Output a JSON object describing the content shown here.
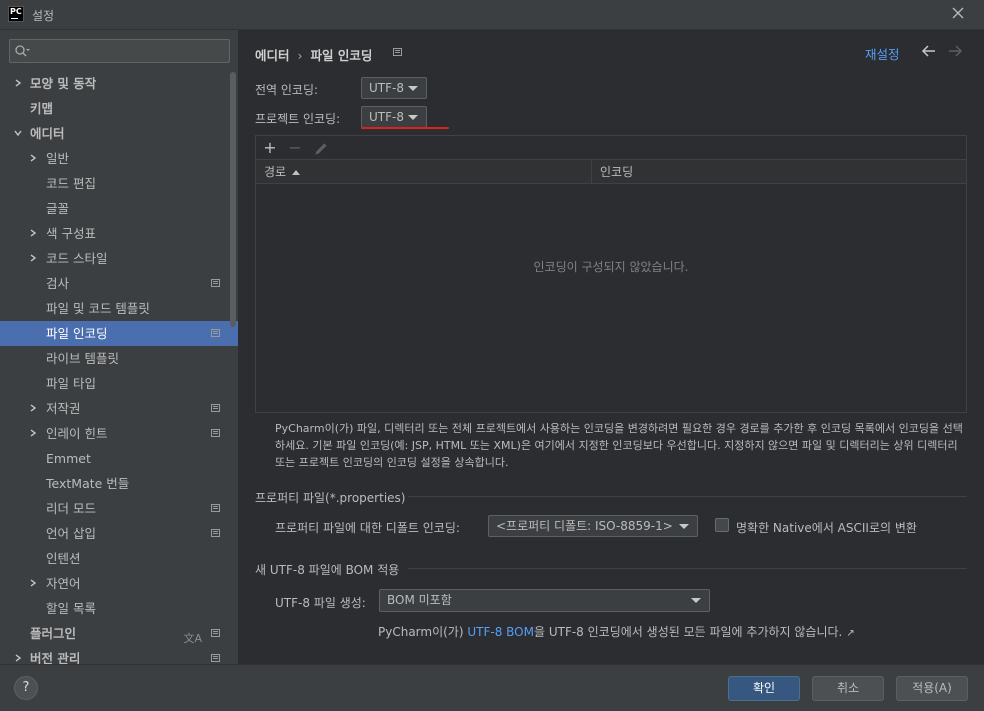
{
  "window": {
    "title": "설정",
    "app_icon_text": "PC"
  },
  "sidebar": {
    "search_value": "",
    "items": [
      {
        "label": "모양 및 동작",
        "level": 0,
        "expandable": true,
        "expanded": false
      },
      {
        "label": "키맵",
        "level": 0,
        "expandable": false
      },
      {
        "label": "에디터",
        "level": 0,
        "expandable": true,
        "expanded": true
      },
      {
        "label": "일반",
        "level": 1,
        "expandable": true,
        "expanded": false
      },
      {
        "label": "코드 편집",
        "level": 1,
        "expandable": false
      },
      {
        "label": "글꼴",
        "level": 1,
        "expandable": false
      },
      {
        "label": "색 구성표",
        "level": 1,
        "expandable": true,
        "expanded": false
      },
      {
        "label": "코드 스타일",
        "level": 1,
        "expandable": true,
        "expanded": false
      },
      {
        "label": "검사",
        "level": 1,
        "expandable": false,
        "project_icon": true
      },
      {
        "label": "파일 및 코드 템플릿",
        "level": 1,
        "expandable": false
      },
      {
        "label": "파일 인코딩",
        "level": 1,
        "expandable": false,
        "project_icon": true,
        "selected": true
      },
      {
        "label": "라이브 템플릿",
        "level": 1,
        "expandable": false
      },
      {
        "label": "파일 타입",
        "level": 1,
        "expandable": false
      },
      {
        "label": "저작권",
        "level": 1,
        "expandable": true,
        "expanded": false,
        "project_icon": true
      },
      {
        "label": "인레이 힌트",
        "level": 1,
        "expandable": true,
        "expanded": false,
        "project_icon": true
      },
      {
        "label": "Emmet",
        "level": 1,
        "expandable": false
      },
      {
        "label": "TextMate 번들",
        "level": 1,
        "expandable": false
      },
      {
        "label": "리더 모드",
        "level": 1,
        "expandable": false,
        "project_icon": true
      },
      {
        "label": "언어 삽입",
        "level": 1,
        "expandable": false,
        "project_icon": true
      },
      {
        "label": "인텐션",
        "level": 1,
        "expandable": false
      },
      {
        "label": "자연어",
        "level": 1,
        "expandable": true,
        "expanded": false
      },
      {
        "label": "할일 목록",
        "level": 1,
        "expandable": false
      },
      {
        "label": "플러그인",
        "level": 0,
        "expandable": false,
        "project_icon": true,
        "lang_icon": true
      },
      {
        "label": "버전 관리",
        "level": 0,
        "expandable": true,
        "expanded": false,
        "project_icon": true
      }
    ]
  },
  "main": {
    "breadcrumb": {
      "parent": "에디터",
      "separator": "›",
      "current": "파일 인코딩"
    },
    "reset_label": "재설정",
    "global_encoding": {
      "label": "전역 인코딩:",
      "value": "UTF-8"
    },
    "project_encoding": {
      "label": "프로젝트 인코딩:",
      "value": "UTF-8"
    },
    "table": {
      "toolbar": {
        "add": "+",
        "remove": "−"
      },
      "columns": [
        "경로",
        "인코딩"
      ],
      "empty_message": "인코딩이 구성되지 않았습니다."
    },
    "description": "PyCharm이(가) 파일, 디렉터리 또는 전체 프로젝트에서 사용하는 인코딩을 변경하려면 필요한 경우 경로를 추가한 후 인코딩 목록에서 인코딩을 선택하세요. 기본 파일 인코딩(예: JSP, HTML 또는 XML)은 여기에서 지정한 인코딩보다 우선합니다. 지정하지 않으면 파일 및 디렉터리는 상위 디렉터리 또는 프로젝트 인코딩의 인코딩 설정을 상속합니다.",
    "properties": {
      "section_title": "프로퍼티 파일(*.properties)",
      "default_label": "프로퍼티 파일에 대한 디폴트 인코딩:",
      "default_value": "<프로퍼티 디폴트: ISO-8859-1>",
      "native_ascii_label": "명확한 Native에서 ASCII로의 변환",
      "native_ascii_checked": false
    },
    "bom": {
      "section_title": "새 UTF-8 파일에 BOM 적용",
      "create_label": "UTF-8 파일 생성:",
      "create_value": "BOM 미포함",
      "note_prefix": "PyCharm이(가) ",
      "note_link": "UTF-8 BOM",
      "note_suffix": "을 UTF-8 인코딩에서 생성된 모든 파일에 추가하지 않습니다.",
      "note_arrow": "↗"
    }
  },
  "footer": {
    "help": "?",
    "ok": "확인",
    "cancel": "취소",
    "apply": "적용(A)"
  },
  "colors": {
    "accent": "#4b6eaf",
    "link": "#589df6",
    "primary_button": "#365880",
    "highlight_underline": "#e0201e"
  }
}
